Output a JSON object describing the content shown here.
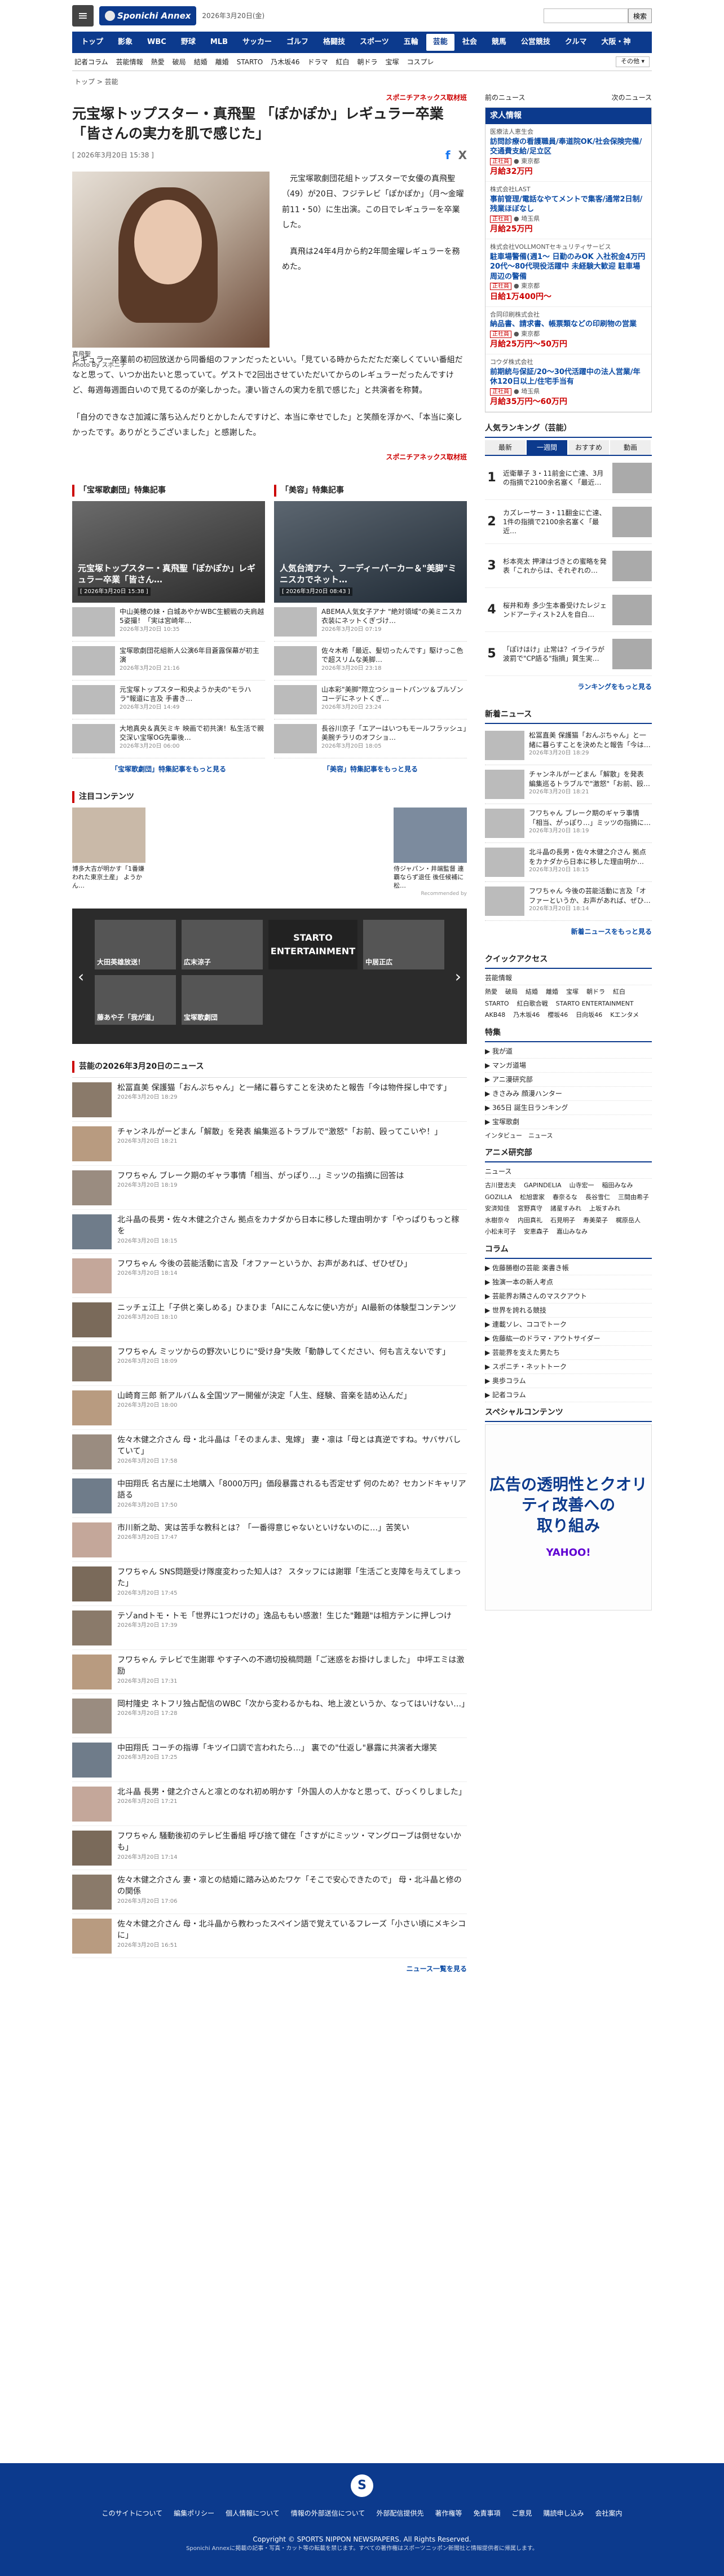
{
  "header": {
    "date": "2026年3月20日(金)",
    "search_button": "検索"
  },
  "nav_main": [
    "トップ",
    "影象",
    "WBC",
    "野球",
    "MLB",
    "サッカー",
    "ゴルフ",
    "格闘技",
    "スポーツ",
    "五輪",
    "芸能",
    "社会",
    "競馬",
    "公営競技",
    "クルマ",
    "大阪・神"
  ],
  "nav_sub": [
    "記者コラム",
    "芸能情報",
    "熱愛",
    "破局",
    "結婚",
    "離婚",
    "STARTO",
    "乃木坂46",
    "ドラマ",
    "紅白",
    "朝ドラ",
    "宝塚",
    "コスプレ"
  ],
  "nav_sub_more": "その他",
  "breadcrumb": "トップ > 芸能",
  "article": {
    "kicker": "スポニチアネックス取材班",
    "title": "元宝塚トップスター・真飛聖 「ぽかぽか」レギュラー卒業「皆さんの実力を肌で感じた」",
    "date": "[ 2026年3月20日 15:38 ]",
    "photo_caption": "真飛聖",
    "photo_credit": "Photo By スポニチ",
    "paras": [
      "元宝塚歌劇団花組トップスターで女優の真飛聖（49）が20日、フジテレビ「ぽかぽか」（月～金曜前11・50）に生出演。この日でレギュラーを卒業した。",
      "真飛は24年4月から約2年間金曜レギュラーを務めた。",
      "レギュラー卒業前の初回放送から同番組のファンだったといい。「見ている時からただただ楽しくていい番組だなと思って、いつか出たいと思っていて。ゲストで2回出させていただいてからのレギュラーだったんですけど、毎週毎週面白いので見てるのが楽しかった。凄い皆さんの実力を肌で感じた」と共演者を称賛。",
      "「自分のできなさ加減に落ち込んだりとかしたんですけど、本当に幸せでした」と笑顔を浮かべ、「本当に楽しかったです。ありがとうございました」と感謝した。"
    ],
    "source": "スポニチアネックス取材班"
  },
  "feature_a": {
    "head": "「宝塚歌劇団」特集記事",
    "title": "元宝塚トップスター・真飛聖「ぽかぽか」レギュラー卒業「皆さん…",
    "date": "[ 2026年3月20日 15:38 ]",
    "items": [
      {
        "t": "中山美穂の妹・白城あやかWBC生観戦の夫肩越5姿撮！「実は宮崎年…",
        "d": "2026年3月20日 10:35"
      },
      {
        "t": "宝塚歌劇団花組新人公演6年目蒼露保幕が初主演",
        "d": "2026年3月20日 21:16"
      },
      {
        "t": "元宝塚トップスター和央ようか夫の\"モラハラ\"報道に言及 手書き…",
        "d": "2026年3月20日 14:49"
      },
      {
        "t": "大地真央＆真矢ミキ 映画で初共演！私生活で親交深い宝塚OG先輩後…",
        "d": "2026年3月20日 06:00"
      }
    ],
    "more": "「宝塚歌劇団」特集記事をもっと見る"
  },
  "feature_b": {
    "head": "「美容」特集記事",
    "title": "人気台湾アナ、フーディーパーカー＆\"美脚\"ミニスカでネット…",
    "date": "[ 2026年3月20日 08:43 ]",
    "items": [
      {
        "t": "ABEMA人気女子アナ \"絶対領域\"の美ミニスカ衣装にネットくぎづけ…",
        "d": "2026年3月20日 07:19"
      },
      {
        "t": "佐々木希「最近、髪切ったんです」駆けっこ色で超スリムな美脚…",
        "d": "2026年3月20日 23:18"
      },
      {
        "t": "山本彩\"美脚\"際立つショートパンツ＆ブルゾンコーデにネットくぎ…",
        "d": "2026年3月20日 23:24"
      },
      {
        "t": "長谷川京子「エアーはいつもモールフラッシュ」美腕チラリのオフショ…",
        "d": "2026年3月20日 18:05"
      }
    ],
    "more": "「美容」特集記事をもっと見る"
  },
  "attention": {
    "head": "注目コンテンツ",
    "items": [
      "博多大吉が明かす「1番嫌われた東京土産」 ようかん…",
      "侍ジャパン・井端監督 連覇ならず退任 後任候補に松…"
    ],
    "label": "Recommended by"
  },
  "carousel": [
    "大田英雄放送！",
    "広末涼子",
    "STARTO ENTERTAINMENT",
    "中居正広",
    "藤あや子「我が道」",
    "宝塚歌劇団"
  ],
  "newslist": {
    "head": "芸能の2026年3月20日のニュース",
    "items": [
      {
        "t": "松冨直美 保護猫「おんぷちゃん」と一緒に暮らすことを決めたと報告「今は物件探し中です」",
        "d": "2026年3月20日 18:29"
      },
      {
        "t": "チャンネルがーどまん「解散」を発表 編集巡るトラブルで\"激怒\"「お前、殴ってこいや！」",
        "d": "2026年3月20日 18:21"
      },
      {
        "t": "フワちゃん ブレーク期のギャラ事情「相当、がっぽり…」ミッツの指摘に回答は",
        "d": "2026年3月20日 18:19"
      },
      {
        "t": "北斗晶の長男・佐々木健之介さん 拠点をカナダから日本に移した理由明かす「やっぱりもっと稼を",
        "d": "2026年3月20日 18:15"
      },
      {
        "t": "フワちゃん 今後の芸能活動に言及「オファーというか、お声があれば、ぜひぜひ」",
        "d": "2026年3月20日 18:14"
      },
      {
        "t": "ニッチェ江上「子供と楽しめる」ひまひま「AIにこんなに使い方が」AI最新の体験型コンテンツ",
        "d": "2026年3月20日 18:10"
      },
      {
        "t": "フワちゃん ミッツからの野次いじりに\"受け身\"失敗「動静してください、何も言えないです」",
        "d": "2026年3月20日 18:09"
      },
      {
        "t": "山崎育三郎 新アルバム＆全国ツアー開催が決定「人生、経験、音楽を詰め込んだ」",
        "d": "2026年3月20日 18:00"
      },
      {
        "t": "佐々木健之介さん 母・北斗晶は「そのまんま、鬼嫁」 妻・凛は「母とは真逆ですね。サバサバしていて」",
        "d": "2026年3月20日 17:58"
      },
      {
        "t": "中田翔氏 名古屋に土地購入「8000万円」価段暴露されるも否定せず 何のため？セカンドキャリア語る",
        "d": "2026年3月20日 17:50"
      },
      {
        "t": "市川新之助、実は苦手な教科とは？「一番得意じゃないといけないのに…」苦笑い",
        "d": "2026年3月20日 17:47"
      },
      {
        "t": "フワちゃん SNS問題受け隊度変わった知人は？ スタッフには謝罪「生活ごと支障を与えてしまった」",
        "d": "2026年3月20日 17:45"
      },
      {
        "t": "テゾandトモ・トモ「世界に1つだけの」逸品ももい感激！生じた\"難題\"は相方テンに押しつけ",
        "d": "2026年3月20日 17:39"
      },
      {
        "t": "フワちゃん テレビで生謝罪 やす子への不適切投稿問題「ご迷惑をお掛けしました」 中坪エミは激励",
        "d": "2026年3月20日 17:31"
      },
      {
        "t": "岡村隆史 ネトフリ独占配信のWBC「次から変わるかもね、地上波というか、なってはいけない…」",
        "d": "2026年3月20日 17:28"
      },
      {
        "t": "中田翔氏 コーチの指導「キツイ口調で言われたら…」 裏での\"仕返し\"暴露に共演者大爆笑",
        "d": "2026年3月20日 17:25"
      },
      {
        "t": "北斗晶 長男・健之介さんと凛とのなれ初め明かす「外国人の人かなと思って、びっくりしました」",
        "d": "2026年3月20日 17:21"
      },
      {
        "t": "フワちゃん 騒動後初のテレビ生番組 呼び捨て健在「さすがにミッツ・マングローブは倒せないかも」",
        "d": "2026年3月20日 17:14"
      },
      {
        "t": "佐々木健之介さん 妻・凛との結婚に踏み込めたワケ「そこで安心できたので」 母・北斗晶と修のの関係",
        "d": "2026年3月20日 17:06"
      },
      {
        "t": "佐々木健之介さん 母・北斗晶から教わったスペイン語で覚えているフレーズ「小さい頃にメキシコに」",
        "d": "2026年3月20日 16:51"
      }
    ],
    "more": "ニュース一覧を見る"
  },
  "side": {
    "prev": "前のニュース",
    "next": "次のニュース",
    "jobs_head": "求人情報",
    "jobs": [
      {
        "co": "医療法人恵生会",
        "tt": "訪問診療の看護職員/奉道院OK/社会保険完備/交通費支給/足立区",
        "loc": "東京都",
        "sal": "月給32万円"
      },
      {
        "co": "株式会社LAST",
        "tt": "事前管理/電話なやてメントで集客/通常2日制/残業ほぼなし",
        "loc": "埼玉県",
        "sal": "月給25万円"
      },
      {
        "co": "株式会社VOLLMONTセキュリティサービス",
        "tt": "駐車場警備(週1～ 日勤のみOK 入社祝金4万円 20代～80代現役活躍中 未経験大歓迎 駐車場周辺の警備",
        "loc": "東京都",
        "sal": "日給1万400円～"
      },
      {
        "co": "合同印刷株式会社",
        "tt": "納品書、請求書、帳票類などの印刷物の営業",
        "loc": "東京都",
        "sal": "月給25万円～50万円"
      },
      {
        "co": "コウダ株式会社",
        "tt": "前期統与保証/20～30代活躍中の法人営業/年休120日以上/住宅手当有",
        "loc": "埼玉県",
        "sal": "月給35万円～60万円"
      }
    ],
    "ranking_head": "人気ランキング（芸能）",
    "ranking_tabs": [
      "最新",
      "一週間",
      "おすすめ",
      "動画"
    ],
    "ranking": [
      "近衛華子 3・11前金に亡達、3月の指摘で2100余名塞く「最近…",
      "カズレーサー 3・11翻金に亡達、1件の指摘で2100余名塞く「最近…",
      "杉本亮太 押津はづきとの蜜略を発表「これからは、それぞれの…",
      "桜井和寿 多少生本番受けたレジェンドアーティスト2人を自白…",
      "「ぽけはけ」止常は？イライラが波罰で\"CP語る\"指摘」質生実…"
    ],
    "ranking_more": "ランキングをもっと見る",
    "latest_head": "新着ニュース",
    "latest": [
      {
        "t": "松冨直美 保護猫「おんぷちゃん」と一緒に暮らすことを決めたと報告「今は…",
        "d": "2026年3月20日 18:29"
      },
      {
        "t": "チャンネルがーどまん「解散」を発表 編集巡るトラブルで\"激怒\"「お前、殴…",
        "d": "2026年3月20日 18:21"
      },
      {
        "t": "フワちゃん ブレーク期のギャラ事情「相当、がっぽり…」ミッツの指摘に…",
        "d": "2026年3月20日 18:19"
      },
      {
        "t": "北斗晶の長男・佐々木健之介さん 拠点をカナダから日本に移した理由明か…",
        "d": "2026年3月20日 18:15"
      },
      {
        "t": "フワちゃん 今後の芸能活動に言及「オファーというか、お声があれば、ぜひ…",
        "d": "2026年3月20日 18:14"
      }
    ],
    "latest_more": "新着ニュースをもっと見る",
    "quick_head": "クイックアクセス",
    "quick_sub": "芸能情報",
    "quick": [
      "熱愛",
      "破局",
      "結婚",
      "離婚",
      "宝塚",
      "朝ドラ",
      "紅白",
      "STARTO",
      "紅白歌合戦",
      "STARTO ENTERTAINMENT",
      "AKB48",
      "乃木坂46",
      "櫻坂46",
      "日向坂46",
      "Kエンタメ"
    ],
    "special_head": "特集",
    "special": [
      "我が道",
      "マンガ道場",
      "アニ漫研究部",
      "きさみみ 顔漫ハンター",
      "365日 誕生日ランキング",
      "宝塚歌劇"
    ],
    "special_sub": "インタビュー　ニュース",
    "anime_head": "アニメ研究部",
    "anime_sub": "ニュース",
    "anime": [
      "古川登志夫",
      "GAPINDELIA",
      "山寺宏一",
      "稲田みなみ",
      "GOZILLA",
      "松旭雲家",
      "春奈るな",
      "長谷雪仁",
      "三間由希子",
      "安済知佳",
      "宮野真守",
      "諸星すみれ",
      "上坂すみれ",
      "水樹奈々",
      "内田真礼",
      "石見明子",
      "寿美菜子",
      "梶原岳人",
      "小松未可子",
      "安恵森子",
      "嘉山みなみ"
    ],
    "column_head": "コラム",
    "columns": [
      "佐藤勝樹の芸能 楽書き帳",
      "独演一本の新人考点",
      "芸能界お隣さんのマスクアウト",
      "世界を誇れる競技",
      "連載ソレ、ココでトーク",
      "佐藤紘一のドラマ・アウトサイダー",
      "芸能界を支えた男たち",
      "スポニチ・ネットトーク",
      "奥歩コラム",
      "記者コラム"
    ],
    "sp_head": "スペシャルコンテンツ",
    "ad_title": "広告の透明性とクオリティ改善への",
    "ad_sub": "取り組み",
    "ad_brand": "YAHOO!"
  },
  "footer": {
    "links": [
      "このサイトについて",
      "編集ポリシー",
      "個人情報について",
      "情報の外部送信について",
      "外部配信提供先",
      "著作権等",
      "免責事項",
      "ご意見",
      "購読申し込み",
      "会社案内"
    ],
    "copy": "Copyright © SPORTS NIPPON NEWSPAPERS. All Rights Reserved.",
    "copy2": "Sponichi Annexに掲載の記事・写真・カット等の転載を禁じます。すべての著作権はスポーツニッポン新聞社と情報提供者に帰属します。"
  }
}
